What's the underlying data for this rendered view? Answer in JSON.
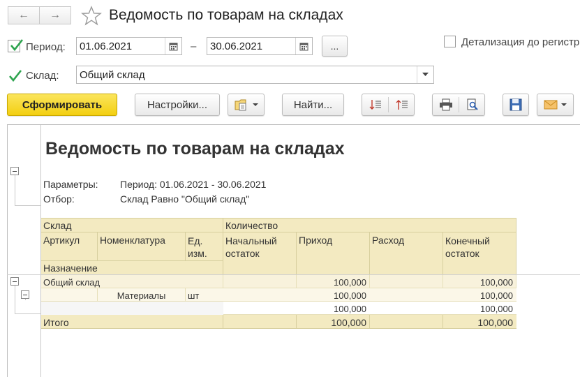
{
  "window": {
    "title": "Ведомость по товарам на складах"
  },
  "nav": {
    "back": "←",
    "forward": "→"
  },
  "params": {
    "period_label": "Период:",
    "period_from": "01.06.2021",
    "period_dash": "–",
    "period_to": "30.06.2021",
    "period_more": "...",
    "detail_label": "Детализация до регистр",
    "warehouse_label": "Склад:",
    "warehouse_value": "Общий склад"
  },
  "toolbar": {
    "generate": "Сформировать",
    "settings": "Настройки...",
    "find": "Найти..."
  },
  "report": {
    "title": "Ведомость по товарам на складах",
    "params_label": "Параметры:",
    "params_value": "Период: 01.06.2021 - 30.06.2021",
    "filter_label": "Отбор:",
    "filter_value": "Склад Равно \"Общий склад\"",
    "headers": {
      "warehouse": "Склад",
      "quantity": "Количество",
      "article": "Артикул",
      "nomenclature": "Номенклатура",
      "unit": "Ед. изм.",
      "opening": "Начальный остаток",
      "income": "Приход",
      "expense": "Расход",
      "closing": "Конечный остаток",
      "purpose": "Назначение"
    },
    "rows": [
      {
        "name": "Общий склад",
        "income": "100,000",
        "closing": "100,000"
      },
      {
        "name": "Материалы",
        "unit": "шт",
        "income": "100,000",
        "closing": "100,000"
      },
      {
        "name": "",
        "income": "100,000",
        "closing": "100,000"
      }
    ],
    "total": {
      "label": "Итого",
      "income": "100,000",
      "closing": "100,000"
    }
  },
  "colors": {
    "accent": "#f3cf11",
    "header_bg": "#f3eac1",
    "check": "#2ea44f"
  }
}
